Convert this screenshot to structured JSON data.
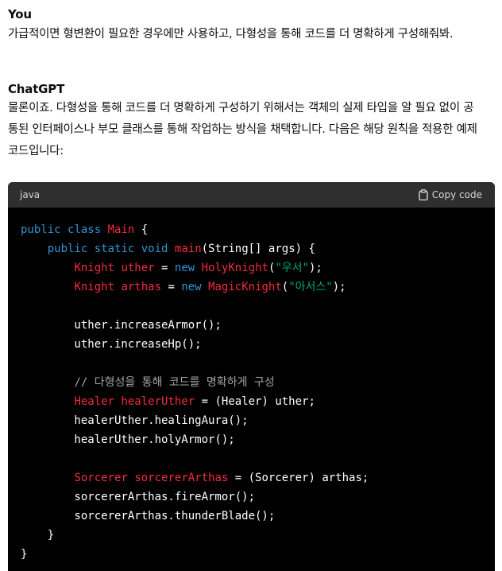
{
  "user": {
    "author": "You",
    "message": "가급적이면 형변환이 필요한 경우에만 사용하고, 다형성을 통해 코드를 더 명확하게 구성해줘봐."
  },
  "assistant": {
    "author": "ChatGPT",
    "message_lines": [
      "물론이죠. 다형성을 통해 코드를 더 명확하게 구성하기 위해서는 객체의 실제 타입을 알 필요 없이 공",
      "통된 인터페이스나 부모 클래스를 통해 작업하는 방식을 채택합니다. 다음은 해당 원칙을 적용한 예제",
      "코드입니다:"
    ]
  },
  "code_block": {
    "language": "java",
    "copy_label": "Copy code",
    "copy_icon": "clipboard-icon",
    "colors": {
      "keyword": "#2e95d3",
      "type": "#f22c3d",
      "string": "#00a67d",
      "comment": "#a3a3a3"
    },
    "lines": [
      [
        [
          "kw",
          "public"
        ],
        [
          "p",
          " "
        ],
        [
          "kw",
          "class"
        ],
        [
          "p",
          " "
        ],
        [
          "ty",
          "Main"
        ],
        [
          "p",
          " {"
        ]
      ],
      [
        [
          "p",
          "    "
        ],
        [
          "kw",
          "public"
        ],
        [
          "p",
          " "
        ],
        [
          "kw",
          "static"
        ],
        [
          "p",
          " "
        ],
        [
          "kw",
          "void"
        ],
        [
          "p",
          " "
        ],
        [
          "ty",
          "main"
        ],
        [
          "p",
          "(String[] args) {"
        ]
      ],
      [
        [
          "p",
          "        "
        ],
        [
          "ty",
          "Knight"
        ],
        [
          "p",
          " "
        ],
        [
          "ty",
          "uther"
        ],
        [
          "p",
          " = "
        ],
        [
          "kw",
          "new"
        ],
        [
          "p",
          " "
        ],
        [
          "ty",
          "HolyKnight"
        ],
        [
          "p",
          "("
        ],
        [
          "st",
          "\"우서\""
        ],
        [
          "p",
          ");"
        ]
      ],
      [
        [
          "p",
          "        "
        ],
        [
          "ty",
          "Knight"
        ],
        [
          "p",
          " "
        ],
        [
          "ty",
          "arthas"
        ],
        [
          "p",
          " = "
        ],
        [
          "kw",
          "new"
        ],
        [
          "p",
          " "
        ],
        [
          "ty",
          "MagicKnight"
        ],
        [
          "p",
          "("
        ],
        [
          "st",
          "\"아서스\""
        ],
        [
          "p",
          ");"
        ]
      ],
      [],
      [
        [
          "p",
          "        uther.increaseArmor();"
        ]
      ],
      [
        [
          "p",
          "        uther.increaseHp();"
        ]
      ],
      [],
      [
        [
          "p",
          "        "
        ],
        [
          "cm",
          "// 다형성을 통해 코드를 명확하게 구성"
        ]
      ],
      [
        [
          "p",
          "        "
        ],
        [
          "ty",
          "Healer"
        ],
        [
          "p",
          " "
        ],
        [
          "ty",
          "healerUther"
        ],
        [
          "p",
          " = (Healer) uther;"
        ]
      ],
      [
        [
          "p",
          "        healerUther.healingAura();"
        ]
      ],
      [
        [
          "p",
          "        healerUther.holyArmor();"
        ]
      ],
      [],
      [
        [
          "p",
          "        "
        ],
        [
          "ty",
          "Sorcerer"
        ],
        [
          "p",
          " "
        ],
        [
          "ty",
          "sorcererArthas"
        ],
        [
          "p",
          " = (Sorcerer) arthas;"
        ]
      ],
      [
        [
          "p",
          "        sorcererArthas.fireArmor();"
        ]
      ],
      [
        [
          "p",
          "        sorcererArthas.thunderBlade();"
        ]
      ],
      [
        [
          "p",
          "    }"
        ]
      ],
      [
        [
          "p",
          "}"
        ]
      ]
    ]
  }
}
